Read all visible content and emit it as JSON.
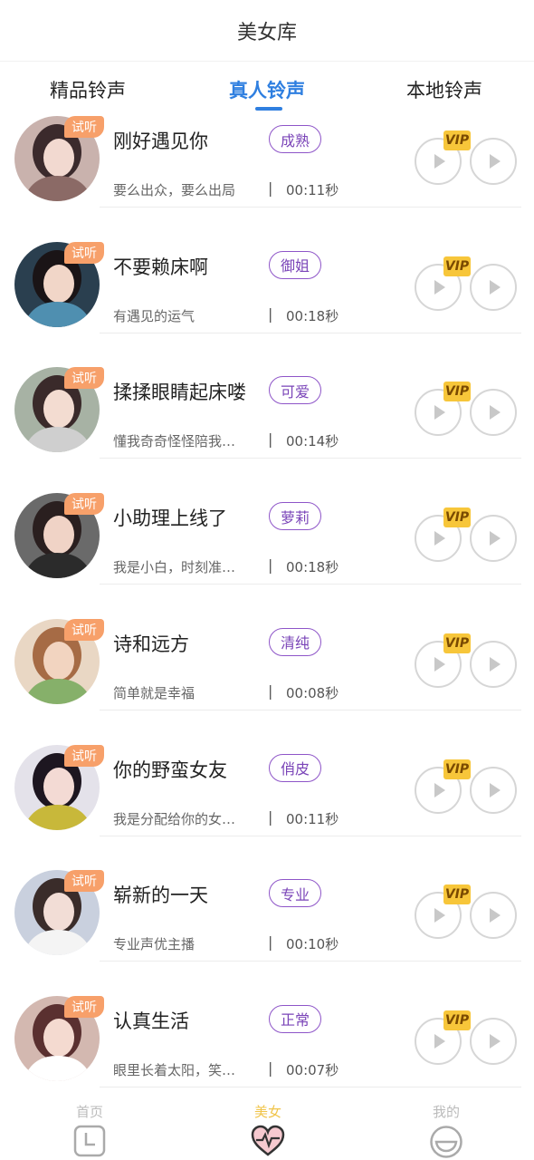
{
  "header": {
    "title": "美女库"
  },
  "tabs": [
    {
      "label": "精品铃声"
    },
    {
      "label": "真人铃声"
    },
    {
      "label": "本地铃声"
    }
  ],
  "badges": {
    "trial": "试听",
    "vip": "VIP"
  },
  "items": [
    {
      "title": "刚好遇见你",
      "tag": "成熟",
      "desc": "要么出众，要么出局",
      "sep": "|",
      "duration": "00:11秒"
    },
    {
      "title": "不要赖床啊",
      "tag": "御姐",
      "desc": "有遇见的运气",
      "sep": "|",
      "duration": "00:18秒"
    },
    {
      "title": "揉揉眼睛起床喽",
      "tag": "可爱",
      "desc": "懂我奇奇怪怪陪我…",
      "sep": "|",
      "duration": "00:14秒"
    },
    {
      "title": "小助理上线了",
      "tag": "萝莉",
      "desc": "我是小白，时刻准…",
      "sep": "|",
      "duration": "00:18秒"
    },
    {
      "title": "诗和远方",
      "tag": "清纯",
      "desc": "简单就是幸福",
      "sep": "|",
      "duration": "00:08秒"
    },
    {
      "title": "你的野蛮女友",
      "tag": "俏皮",
      "desc": "我是分配给你的女…",
      "sep": "|",
      "duration": "00:11秒"
    },
    {
      "title": "崭新的一天",
      "tag": "专业",
      "desc": "专业声优主播",
      "sep": "|",
      "duration": "00:10秒"
    },
    {
      "title": "认真生活",
      "tag": "正常",
      "desc": "眼里长着太阳，笑…",
      "sep": "|",
      "duration": "00:07秒"
    }
  ],
  "bottom_nav": [
    {
      "label": "首页",
      "icon": "home-clock-icon"
    },
    {
      "label": "美女",
      "icon": "heart-pulse-icon"
    },
    {
      "label": "我的",
      "icon": "smile-face-icon"
    }
  ],
  "colors": {
    "accent_blue": "#2f7fe0",
    "tag_purple": "#8e55c8",
    "trial_orange": "#f7a06a",
    "vip_gold": "#f7c63a",
    "nav_active": "#f0c44a"
  }
}
